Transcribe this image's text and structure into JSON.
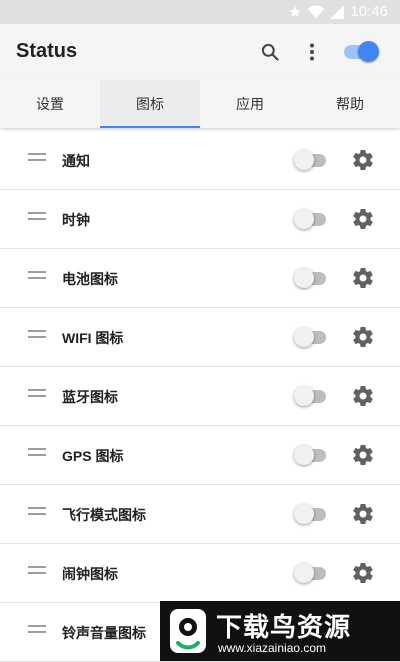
{
  "status_bar": {
    "time": "10:46",
    "icons": [
      "star-icon",
      "wifi-icon",
      "signal-icon"
    ]
  },
  "app_bar": {
    "title": "Status",
    "actions": [
      "search-icon",
      "more-vert-icon"
    ],
    "master_switch_on": true
  },
  "colors": {
    "accent": "#4285f4",
    "accent_light": "#9ec3f5",
    "appbar_bg": "#f5f5f5"
  },
  "tabs": [
    {
      "label": "设置",
      "active": false
    },
    {
      "label": "图标",
      "active": true
    },
    {
      "label": "应用",
      "active": false
    },
    {
      "label": "帮助",
      "active": false
    }
  ],
  "items": [
    {
      "label": "通知",
      "enabled": false
    },
    {
      "label": "时钟",
      "enabled": false
    },
    {
      "label": "电池图标",
      "enabled": false
    },
    {
      "label": "WIFI 图标",
      "enabled": false
    },
    {
      "label": "蓝牙图标",
      "enabled": false
    },
    {
      "label": "GPS 图标",
      "enabled": false
    },
    {
      "label": "飞行模式图标",
      "enabled": false
    },
    {
      "label": "闹钟图标",
      "enabled": false
    },
    {
      "label": "铃声音量图标",
      "enabled": false
    }
  ],
  "watermark": {
    "title": "下载鸟资源",
    "url": "www.xiazainiao.com"
  }
}
